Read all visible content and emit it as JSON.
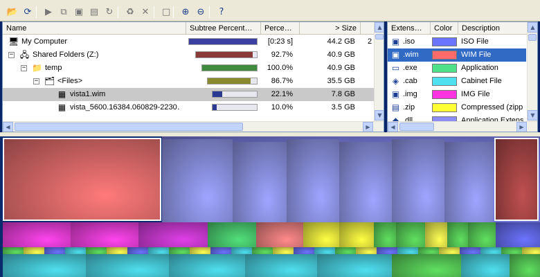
{
  "toolbar": {
    "buttons": [
      {
        "name": "open-folder-icon",
        "glyph": "📂"
      },
      {
        "name": "refresh-icon",
        "glyph": "⟳"
      },
      {
        "name": "play-icon",
        "glyph": "▶"
      },
      {
        "name": "copy-icon",
        "glyph": "⧉"
      },
      {
        "name": "explorer-icon",
        "glyph": "▣"
      },
      {
        "name": "command-prompt-icon",
        "glyph": "▤"
      },
      {
        "name": "refresh-selected-icon",
        "glyph": "↻"
      },
      {
        "name": "recycle-icon",
        "glyph": "♻"
      },
      {
        "name": "delete-icon",
        "glyph": "✕"
      },
      {
        "name": "new-folder-icon",
        "glyph": "□"
      },
      {
        "name": "zoom-in-icon",
        "glyph": "⊕"
      },
      {
        "name": "zoom-out-icon",
        "glyph": "⊖"
      },
      {
        "name": "help-icon",
        "glyph": "?"
      }
    ]
  },
  "tree": {
    "columns": {
      "name": "Name",
      "subtree": "Subtree Percent…",
      "percent": "Perce…",
      "size": "> Size"
    },
    "rows": [
      {
        "label": "My Computer",
        "icon": "computer-icon",
        "glyph": "🖥",
        "fill": 1.0,
        "color": "#3a3fa0",
        "percent": "[0:23 s]",
        "size": "44.2 GB",
        "extra": "2",
        "level": 0,
        "expander": ""
      },
      {
        "label": "Shared Folders (Z:)",
        "icon": "network-drive-icon",
        "glyph": "🖧",
        "fill": 0.927,
        "color": "#8b3a3a",
        "percent": "92.7%",
        "size": "40.9 GB",
        "extra": "",
        "level": 0,
        "expander": "−"
      },
      {
        "label": "temp",
        "icon": "folder-icon",
        "glyph": "📁",
        "fill": 1.0,
        "color": "#3e8a3e",
        "percent": "100.0%",
        "size": "40.9 GB",
        "extra": "",
        "level": 1,
        "expander": "−"
      },
      {
        "label": "<Files>",
        "icon": "files-icon",
        "glyph": "🗂",
        "fill": 0.867,
        "color": "#8c8a2e",
        "percent": "86.7%",
        "size": "35.5 GB",
        "extra": "",
        "level": 2,
        "expander": "−"
      },
      {
        "label": "vista1.wim",
        "icon": "file-icon",
        "glyph": "▦",
        "fill": 0.221,
        "color": "#2a3a92",
        "percent": "22.1%",
        "size": "7.8 GB",
        "extra": "",
        "level": 3,
        "expander": "",
        "selected": true
      },
      {
        "label": "vista_5600.16384.060829-2230…",
        "icon": "file-icon",
        "glyph": "▦",
        "fill": 0.1,
        "color": "#2a3a92",
        "percent": "10.0%",
        "size": "3.5 GB",
        "extra": "",
        "level": 3,
        "expander": ""
      }
    ]
  },
  "extensions": {
    "columns": {
      "ext": "Extens…",
      "color": "Color",
      "desc": "Description"
    },
    "rows": [
      {
        "ext": ".iso",
        "color": "#6b74ff",
        "desc": "ISO File",
        "glyph": "▣"
      },
      {
        "ext": ".wim",
        "color": "#ff6b6b",
        "desc": "WIM File",
        "glyph": "▣",
        "selected": true
      },
      {
        "ext": ".exe",
        "color": "#4fe08a",
        "desc": "Application",
        "glyph": "▭"
      },
      {
        "ext": ".cab",
        "color": "#4fe0f0",
        "desc": "Cabinet File",
        "glyph": "◈"
      },
      {
        "ext": ".img",
        "color": "#ff33e0",
        "desc": "IMG File",
        "glyph": "▣"
      },
      {
        "ext": ".zip",
        "color": "#ffff33",
        "desc": "Compressed (zipp",
        "glyph": "▤"
      },
      {
        "ext": ".dll",
        "color": "#8c8cf5",
        "desc": "Application Extens",
        "glyph": "◆"
      }
    ]
  }
}
